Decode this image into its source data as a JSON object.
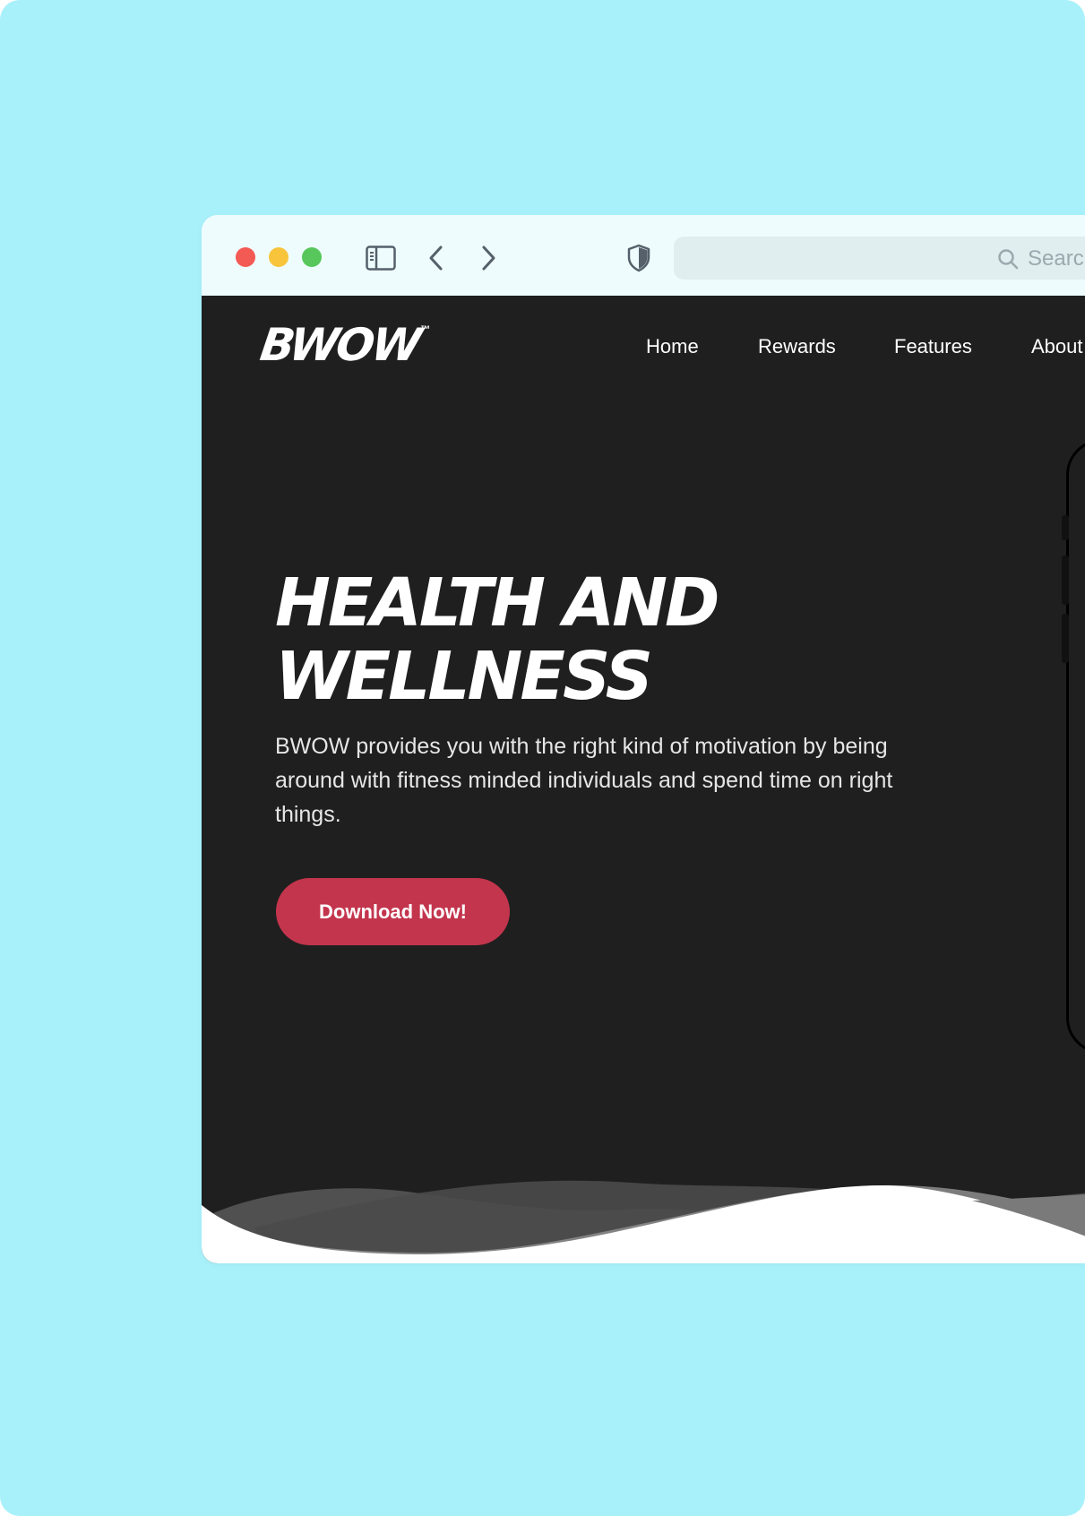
{
  "browser": {
    "search_placeholder": "Search",
    "icons": {
      "sidebar": "sidebar-icon",
      "back": "chevron-left-icon",
      "forward": "chevron-right-icon",
      "privacy": "shield-icon",
      "search": "search-icon"
    }
  },
  "site": {
    "logo": "BWOW",
    "logo_tm": "™",
    "nav": [
      "Home",
      "Rewards",
      "Features",
      "About"
    ],
    "hero": {
      "title_line1": "HEALTH AND",
      "title_line2": "WELLNESS",
      "description": "BWOW provides you with the right kind of motivation by being around with fitness minded individuals and spend time on right things.",
      "cta_label": "Download Now!"
    }
  },
  "colors": {
    "background": "#a8f1fb",
    "toolbar": "#effcfe",
    "site_background": "#1f1f1f",
    "cta": "#c3354d",
    "text": "#ffffff"
  }
}
